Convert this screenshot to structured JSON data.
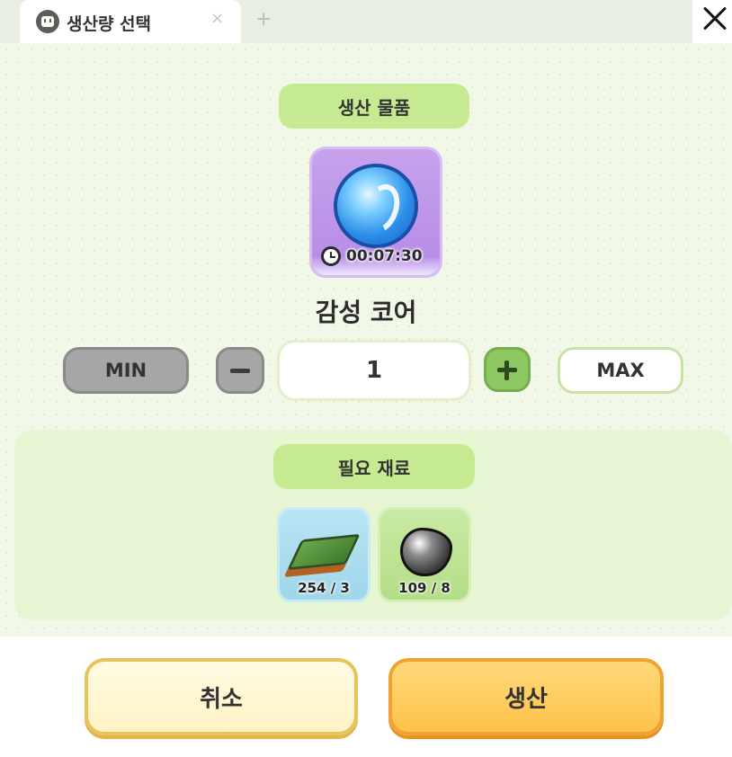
{
  "tab": {
    "title": "생산량 선택",
    "close_glyph": "×",
    "add_glyph": "+"
  },
  "produce_section": {
    "title": "생산 물품",
    "item_name": "감성 코어",
    "timer": "00:07:30"
  },
  "quantity": {
    "min_label": "MIN",
    "max_label": "MAX",
    "value": "1"
  },
  "materials_section": {
    "title": "필요 재료",
    "items": [
      {
        "count": "254 / 3",
        "icon": "board-icon"
      },
      {
        "count": "109 / 8",
        "icon": "ore-icon"
      }
    ]
  },
  "actions": {
    "cancel_label": "취소",
    "produce_label": "생산"
  },
  "colors": {
    "panel_bg": "#f2f8e7",
    "pill_green": "#c6ea91",
    "produce_orange": "#ffc24a",
    "cancel_cream": "#fff3c4"
  }
}
